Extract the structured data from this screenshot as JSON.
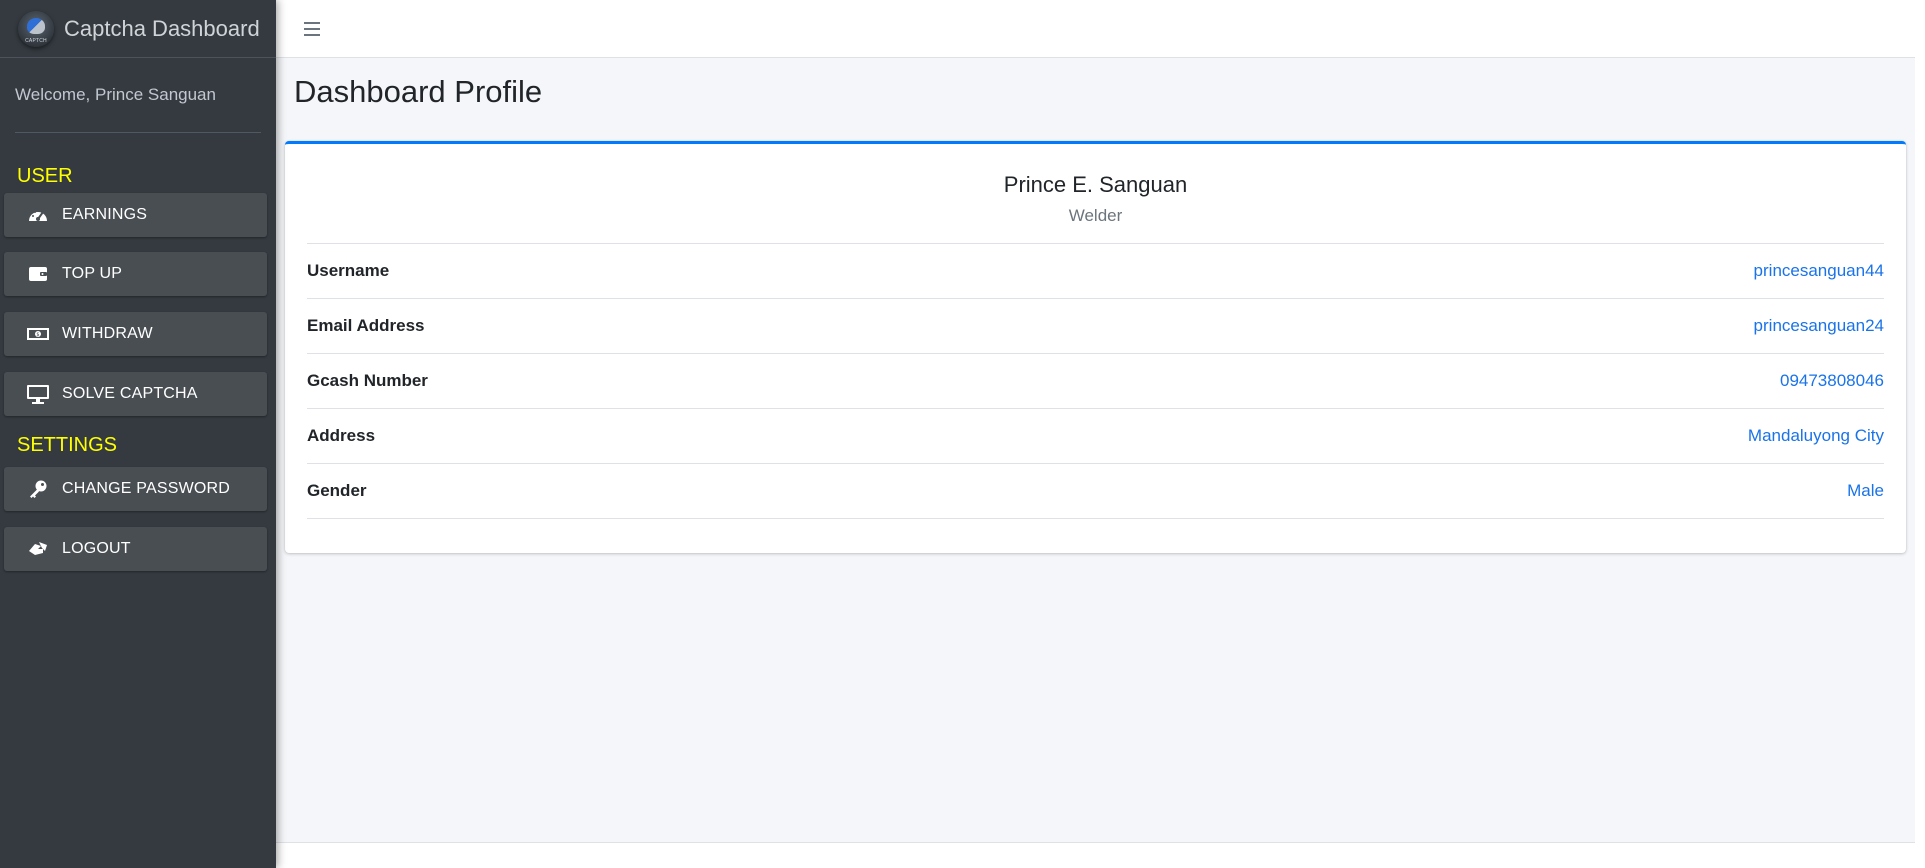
{
  "brand": {
    "title": "Captcha Dashboard",
    "logo_text": "CAPTCH",
    "logo_icon": "captcha-logo-icon"
  },
  "sidebar": {
    "welcome": "Welcome, Prince Sanguan",
    "sections": [
      {
        "header": "USER",
        "items": [
          {
            "label": "EARNINGS",
            "icon": "tachometer-icon"
          },
          {
            "label": "TOP UP",
            "icon": "wallet-icon"
          },
          {
            "label": "WITHDRAW",
            "icon": "money-bill-icon"
          },
          {
            "label": "SOLVE CAPTCHA",
            "icon": "desktop-icon"
          }
        ]
      },
      {
        "header": "SETTINGS",
        "items": [
          {
            "label": "CHANGE PASSWORD",
            "icon": "key-icon"
          },
          {
            "label": "LOGOUT",
            "icon": "logout-icon"
          }
        ]
      }
    ]
  },
  "topbar": {
    "menu_icon": "hamburger-icon"
  },
  "page": {
    "title": "Dashboard Profile"
  },
  "profile": {
    "name": "Prince E. Sanguan",
    "occupation": "Welder",
    "fields": [
      {
        "label": "Username",
        "value": "princesanguan44"
      },
      {
        "label": "Email Address",
        "value": "princesanguan24"
      },
      {
        "label": "Gcash Number",
        "value": "09473808046"
      },
      {
        "label": "Address",
        "value": "Mandaluyong City"
      },
      {
        "label": "Gender",
        "value": "Male"
      }
    ]
  },
  "colors": {
    "sidebar_bg": "#343a40",
    "section_header": "#ffff00",
    "accent": "#007bff",
    "link": "#1a73e8"
  }
}
